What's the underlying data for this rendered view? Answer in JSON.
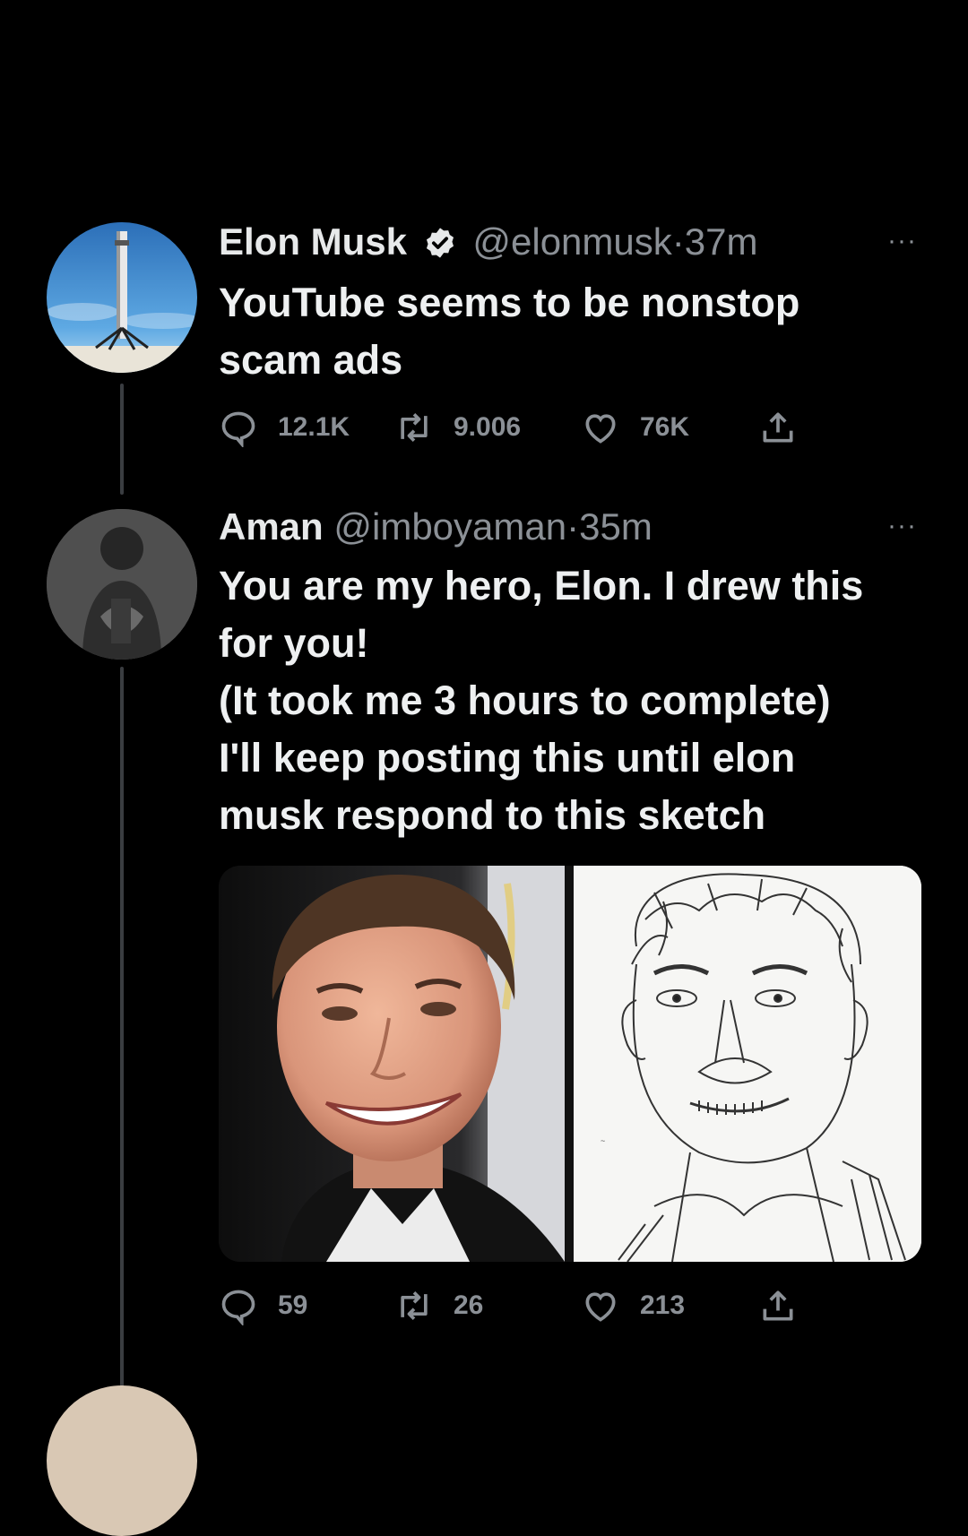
{
  "tweet1": {
    "name": "Elon Musk",
    "handle": "@elonmusk",
    "dot": "·",
    "time": "37m",
    "more": "···",
    "text": "YouTube seems to be nonstop scam ads",
    "replies": "12.1K",
    "retweets": "9.006",
    "likes": "76K",
    "avatar_icon": "rocket-booster-avatar"
  },
  "tweet2": {
    "name": "Aman",
    "handle": "@imboyaman",
    "dot": "·",
    "time": "35m",
    "more": "···",
    "text_line1": "You are my hero, Elon. I drew this",
    "text_line2": "for you!",
    "text_line3": "(It took me 3 hours to complete)",
    "text_line4": "I'll keep posting this until elon",
    "text_line5": "musk respond to this sketch",
    "replies": "59",
    "retweets": "26",
    "likes": "213",
    "image_left": "photo-of-elon",
    "image_right": "pencil-sketch"
  },
  "colors": {
    "background": "#000000",
    "text": "#e7e9ea",
    "muted": "#8b9096",
    "thread_line": "#3a3d41"
  }
}
